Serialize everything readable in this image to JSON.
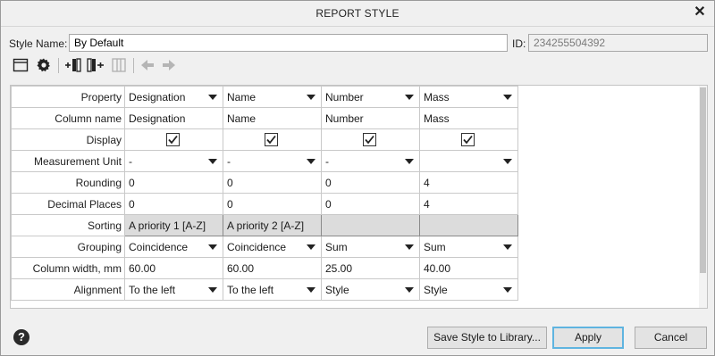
{
  "window": {
    "title": "REPORT STYLE",
    "close_icon": "close-icon"
  },
  "style_name": {
    "label": "Style Name:",
    "value": "By Default"
  },
  "id_field": {
    "label": "ID:",
    "value": "234255504392"
  },
  "toolbar": {
    "icons": [
      "window-icon",
      "gear-icon",
      "insert-column-left-icon",
      "insert-column-right-icon",
      "delete-column-icon",
      "arrow-left-icon",
      "arrow-right-icon"
    ]
  },
  "grid": {
    "row_headers": [
      "Property",
      "Column name",
      "Display",
      "Measurement Unit",
      "Rounding",
      "Decimal Places",
      "Sorting",
      "Grouping",
      "Column width, mm",
      "Alignment"
    ],
    "columns": [
      {
        "property": "Designation",
        "column_name": "Designation",
        "display": true,
        "unit": "-",
        "rounding": "0",
        "decimals": "0",
        "sorting": "A priority 1 [A-Z]",
        "grouping": "Coincidence",
        "width": "60.00",
        "alignment": "To the left"
      },
      {
        "property": "Name",
        "column_name": "Name",
        "display": true,
        "unit": "-",
        "rounding": "0",
        "decimals": "0",
        "sorting": "A priority 2 [A-Z]",
        "grouping": "Coincidence",
        "width": "60.00",
        "alignment": "To the left"
      },
      {
        "property": "Number",
        "column_name": "Number",
        "display": true,
        "unit": "-",
        "rounding": "0",
        "decimals": "0",
        "sorting": "",
        "grouping": "Sum",
        "width": "25.00",
        "alignment": "Style"
      },
      {
        "property": "Mass",
        "column_name": "Mass",
        "display": true,
        "unit": "",
        "rounding": "4",
        "decimals": "4",
        "sorting": "",
        "grouping": "Sum",
        "width": "40.00",
        "alignment": "Style"
      }
    ]
  },
  "buttons": {
    "save": "Save Style to Library...",
    "apply": "Apply",
    "cancel": "Cancel"
  },
  "help_icon": "help-icon"
}
